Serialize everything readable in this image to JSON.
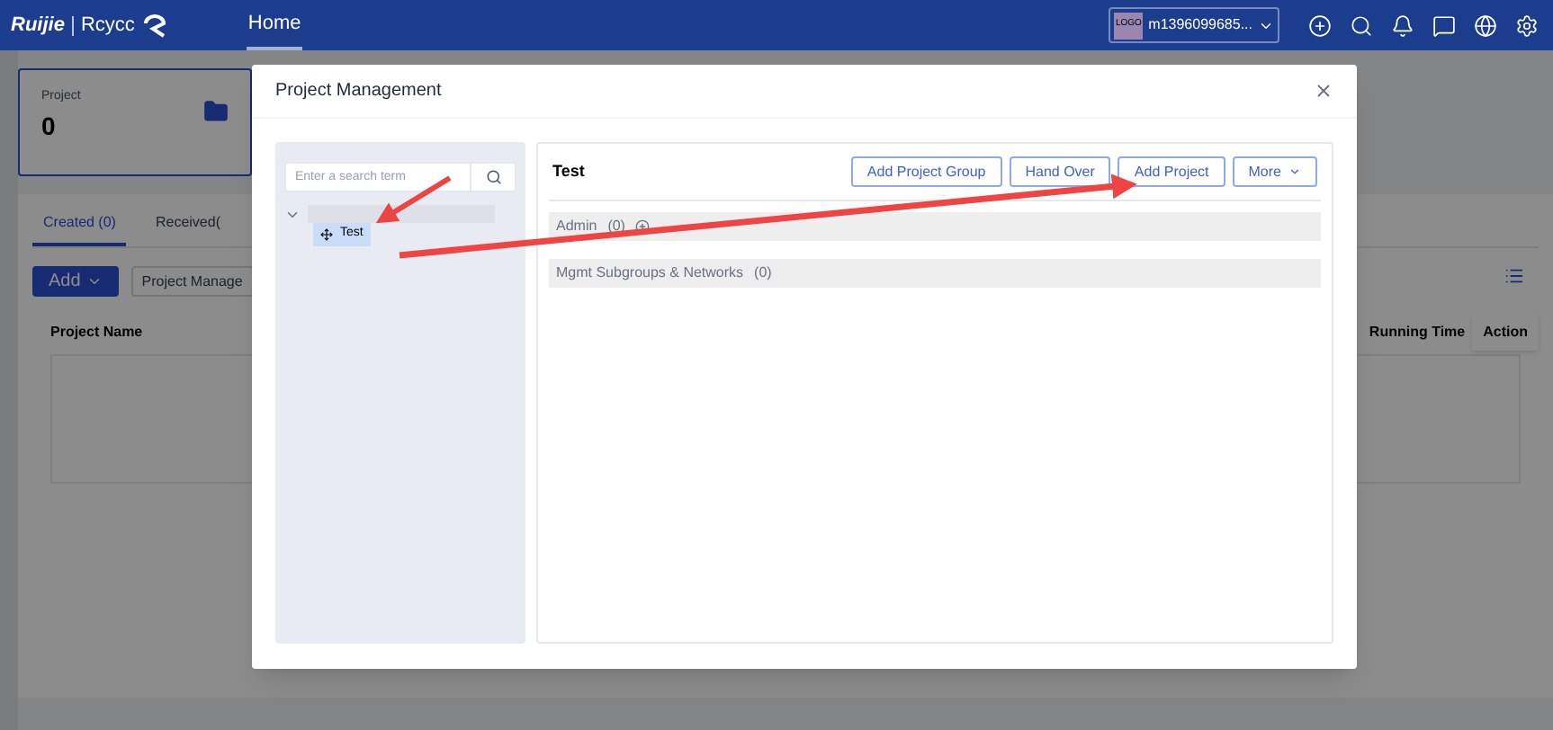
{
  "header": {
    "brand": "Ruijie",
    "brand_sub": "Rcycc",
    "nav": [
      {
        "label": "Home",
        "selected": true
      }
    ],
    "account": {
      "logo": "LOGO",
      "name": "m1396099685..."
    }
  },
  "page": {
    "project_card": {
      "label": "Project",
      "count": "0"
    },
    "tabs": [
      {
        "label": "Created (0)",
        "selected": true
      },
      {
        "label": "Received(",
        "selected": false
      }
    ],
    "add_button": "Add",
    "manager_button": "Project Manage",
    "columns": [
      "Project Name",
      "Running Time",
      "Action"
    ]
  },
  "modal": {
    "title": "Project Management",
    "search": {
      "placeholder": "Enter a search term"
    },
    "tree": {
      "expanded": true,
      "children": [
        {
          "label": "Test",
          "selected": true
        }
      ]
    },
    "panel_title": "Test",
    "buttons": [
      {
        "label": "Add Project Group",
        "kind": "button"
      },
      {
        "label": "Hand Over",
        "kind": "button"
      },
      {
        "label": "Add Project",
        "kind": "button"
      },
      {
        "label": "More",
        "kind": "dropdown"
      }
    ],
    "groups": [
      {
        "label": "Admin",
        "count": "(0)",
        "addable": true
      },
      {
        "label": "Mgmt Subgroups & Networks",
        "count": "(0)",
        "addable": false
      }
    ]
  }
}
